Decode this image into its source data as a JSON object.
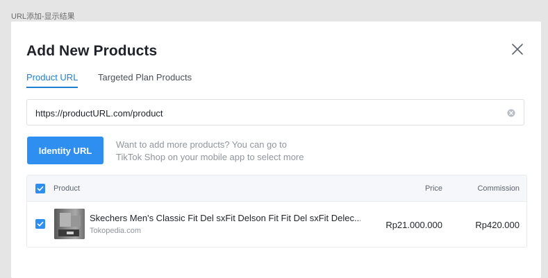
{
  "page_caption": "URL添加-显示结果",
  "modal": {
    "title": "Add New Products",
    "close_icon": "close-icon"
  },
  "tabs": [
    {
      "label": "Product URL",
      "active": true
    },
    {
      "label": "Targeted Plan Products",
      "active": false
    }
  ],
  "url_input": {
    "value": "https://productURL.com/product",
    "clear_icon": "clear-circle-icon"
  },
  "identify_button": {
    "label": "Identity URL"
  },
  "hint": {
    "line1": "Want to add more products? You can go to",
    "line2": "TikTok Shop on your mobile app to select more"
  },
  "table": {
    "select_all_checked": true,
    "columns": {
      "product": "Product",
      "price": "Price",
      "commission": "Commission"
    },
    "rows": [
      {
        "checked": true,
        "name": "Skechers Men's Classic Fit Del sxFit Delson Fit Fit Del sxFit Delec...",
        "source": "Tokopedia.com",
        "price": "Rp21.000.000",
        "commission": "Rp420.000"
      }
    ]
  },
  "colors": {
    "accent": "#2f8ff1",
    "active_tab": "#1e7fd3",
    "background": "#e5e5e5",
    "muted_text": "#8f959e"
  }
}
